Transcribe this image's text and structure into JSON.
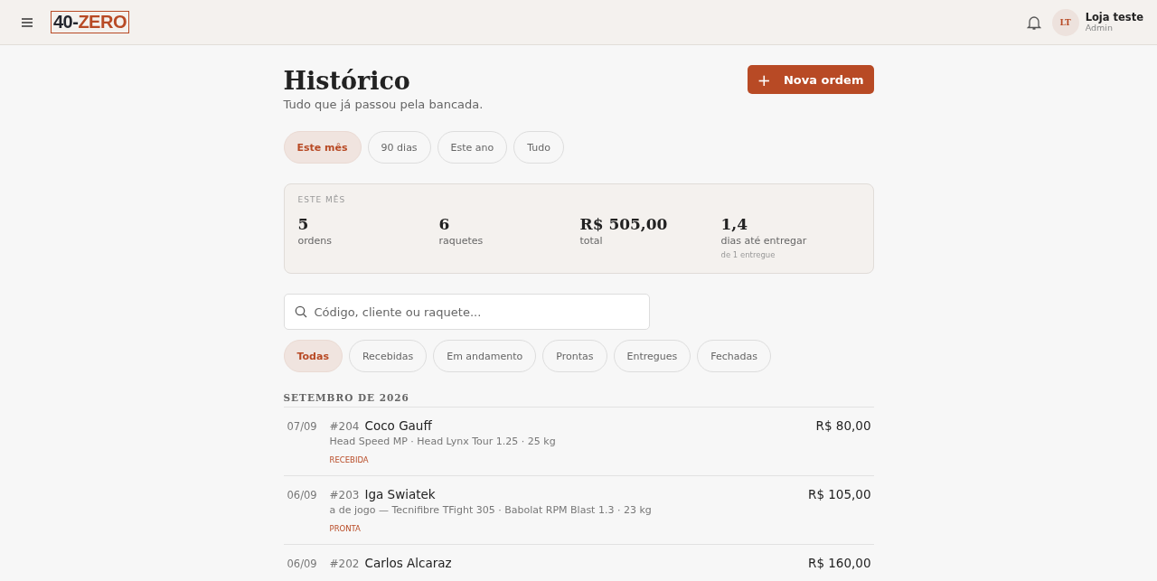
{
  "header": {
    "logo": {
      "prefix": "40-",
      "accent": "ZERO"
    },
    "user": {
      "initials": "LT",
      "name": "Loja teste",
      "role": "Admin"
    }
  },
  "page": {
    "title": "Histórico",
    "subtitle": "Tudo que já passou pela bancada.",
    "new_button": {
      "icon": "+",
      "label": "Nova ordem"
    }
  },
  "periods": [
    {
      "label": "Este mês",
      "selected": true
    },
    {
      "label": "90 dias",
      "selected": false
    },
    {
      "label": "Este ano",
      "selected": false
    },
    {
      "label": "Tudo",
      "selected": false
    }
  ],
  "summary": {
    "heading": "ESTE MÊS",
    "stats": [
      {
        "value": "5",
        "label": "ordens"
      },
      {
        "value": "6",
        "label": "raquetes"
      },
      {
        "value": "R$ 505,00",
        "label": "total"
      },
      {
        "value": "1,4",
        "label": "dias até entregar",
        "note": "de 1 entregue"
      }
    ]
  },
  "search": {
    "placeholder": "Código, cliente ou raquete..."
  },
  "statuses": [
    {
      "label": "Todas",
      "selected": true
    },
    {
      "label": "Recebidas",
      "selected": false
    },
    {
      "label": "Em andamento",
      "selected": false
    },
    {
      "label": "Prontas",
      "selected": false
    },
    {
      "label": "Entregues",
      "selected": false
    },
    {
      "label": "Fechadas",
      "selected": false
    }
  ],
  "month": "SETEMBRO DE 2026",
  "orders": [
    {
      "date": "07/09",
      "code": "#204",
      "client": "Coco Gauff",
      "details": "Head Speed MP · Head Lynx Tour 1.25 · 25 kg",
      "status": "RECEBIDA",
      "price": "R$ 80,00"
    },
    {
      "date": "06/09",
      "code": "#203",
      "client": "Iga Swiatek",
      "details": "a de jogo — Tecnifibre TFight 305 · Babolat RPM Blast 1.3 · 23 kg",
      "status": "PRONTA",
      "price": "R$ 105,00"
    },
    {
      "date": "06/09",
      "code": "#202",
      "client": "Carlos Alcaraz",
      "price": "R$ 160,00"
    }
  ]
}
